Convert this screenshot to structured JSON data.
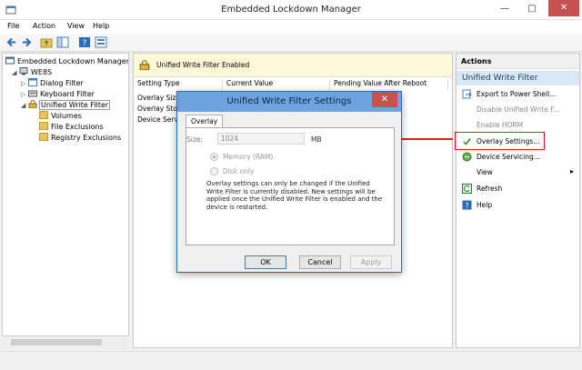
{
  "window": {
    "title": "Embedded Lockdown Manager"
  },
  "menu": [
    "File",
    "Action",
    "View",
    "Help"
  ],
  "tree": {
    "root": "Embedded Lockdown Manager",
    "computer": "WE8S",
    "items": [
      "Dialog Filter",
      "Keyboard Filter",
      "Unified Write Filter"
    ],
    "children": [
      "Volumes",
      "File Exclusions",
      "Registry Exclusions"
    ]
  },
  "center": {
    "banner": "Unified Write Filter Enabled",
    "columns": [
      "Setting Type",
      "Current Value",
      "Pending Value After Reboot"
    ],
    "rows": [
      "Overlay Size",
      "Overlay Stor",
      "Device Servi"
    ]
  },
  "actions": {
    "header": "Actions",
    "section": "Unified Write Filter",
    "items": [
      {
        "label": "Export to Power Shell...",
        "disabled": false
      },
      {
        "label": "Disable Unified Write F...",
        "disabled": true
      },
      {
        "label": "Enable HORM",
        "disabled": true
      },
      {
        "label": "Overlay Settings...",
        "disabled": false
      },
      {
        "label": "Device Servicing...",
        "disabled": false
      },
      {
        "label": "View",
        "disabled": false
      },
      {
        "label": "Refresh",
        "disabled": false
      },
      {
        "label": "Help",
        "disabled": false
      }
    ]
  },
  "dialog": {
    "title": "Unified Write Filter Settings",
    "tab": "Overlay",
    "size_label": "Size:",
    "size_value": "1024",
    "size_unit": "MB",
    "radio_memory": "Memory (RAM)",
    "radio_disk": "Disk only",
    "note": "Overlay settings can only be changed if the Unified Write Filter is currently disabled.  New settings will be applied once the Unified Write Filter is enabled and the device is restarted.",
    "ok": "OK",
    "cancel": "Cancel",
    "apply": "Apply"
  },
  "colors": {
    "highlight": "#e02020",
    "dialog_title": "#6ea3df",
    "close": "#c75050"
  }
}
